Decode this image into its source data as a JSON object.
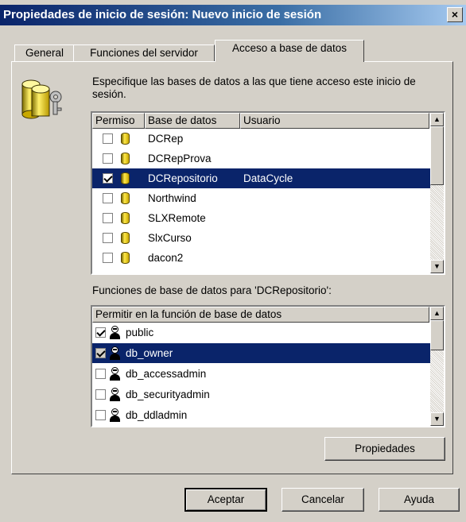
{
  "window": {
    "title": "Propiedades de inicio de sesión: Nuevo inicio de sesión",
    "close_glyph": "×"
  },
  "tabs": [
    {
      "label": "General",
      "active": false
    },
    {
      "label": "Funciones del servidor",
      "active": false
    },
    {
      "label": "Acceso a base de datos",
      "active": true
    }
  ],
  "description": "Especifique las bases de datos a las que tiene acceso este inicio de sesión.",
  "databases_list": {
    "columns": [
      "Permiso",
      "Base de datos",
      "Usuario"
    ],
    "rows": [
      {
        "checked": false,
        "database": "DCRep",
        "user": "",
        "selected": false
      },
      {
        "checked": false,
        "database": "DCRepProva",
        "user": "",
        "selected": false
      },
      {
        "checked": true,
        "database": "DCRepositorio",
        "user": "DataCycle",
        "selected": true
      },
      {
        "checked": false,
        "database": "Northwind",
        "user": "",
        "selected": false
      },
      {
        "checked": false,
        "database": "SLXRemote",
        "user": "",
        "selected": false
      },
      {
        "checked": false,
        "database": "SlxCurso",
        "user": "",
        "selected": false
      },
      {
        "checked": false,
        "database": "dacon2",
        "user": "",
        "selected": false
      }
    ]
  },
  "roles_label": "Funciones de base de datos para 'DCRepositorio':",
  "roles_list": {
    "columns": [
      "Permitir en la función de base de datos"
    ],
    "rows": [
      {
        "checked": true,
        "role": "public",
        "selected": false
      },
      {
        "checked": true,
        "role": "db_owner",
        "selected": true
      },
      {
        "checked": false,
        "role": "db_accessadmin",
        "selected": false
      },
      {
        "checked": false,
        "role": "db_securityadmin",
        "selected": false
      },
      {
        "checked": false,
        "role": "db_ddladmin",
        "selected": false
      }
    ]
  },
  "buttons": {
    "properties": "Propiedades",
    "ok": "Aceptar",
    "cancel": "Cancelar",
    "help": "Ayuda"
  },
  "icons": {
    "login_icon": "database-key-icon",
    "db_row_icon": "database-cylinder-icon",
    "role_icon": "user-role-icon",
    "scroll_up": "▲",
    "scroll_down": "▼"
  }
}
